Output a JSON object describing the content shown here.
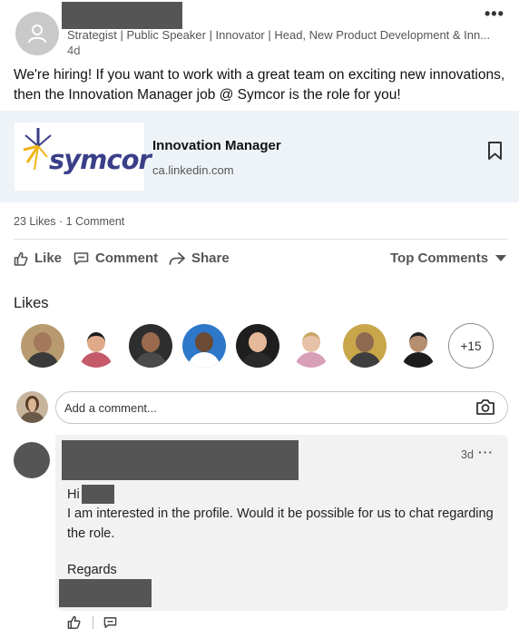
{
  "post": {
    "headline": "Strategist | Public Speaker | Innovator | Head, New Product Development & Inn...",
    "timestamp": "4d",
    "body": "We're hiring! If you want to work with a great team on exciting new innovations, then the Innovation Manager job @ Symcor is the role for you!"
  },
  "link_card": {
    "logo_text": "symcor",
    "title": "Innovation Manager",
    "domain": "ca.linkedin.com"
  },
  "social": {
    "counts": "23 Likes · 1 Comment"
  },
  "actions": {
    "like": "Like",
    "comment": "Comment",
    "share": "Share",
    "sort": "Top Comments"
  },
  "likes": {
    "heading": "Likes",
    "more": "+15"
  },
  "comment_box": {
    "placeholder": "Add a comment..."
  },
  "comment": {
    "time": "3d",
    "greeting": "Hi",
    "text": "I am interested in the profile. Would it be possible for us to chat regarding the role.",
    "closing": "Regards"
  },
  "colors": {
    "card_bg": "#eef3f8",
    "bubble_bg": "#f2f2f2",
    "redaction": "#555555",
    "logo_blue": "#3a3f88",
    "logo_yellow": "#f2b418"
  }
}
